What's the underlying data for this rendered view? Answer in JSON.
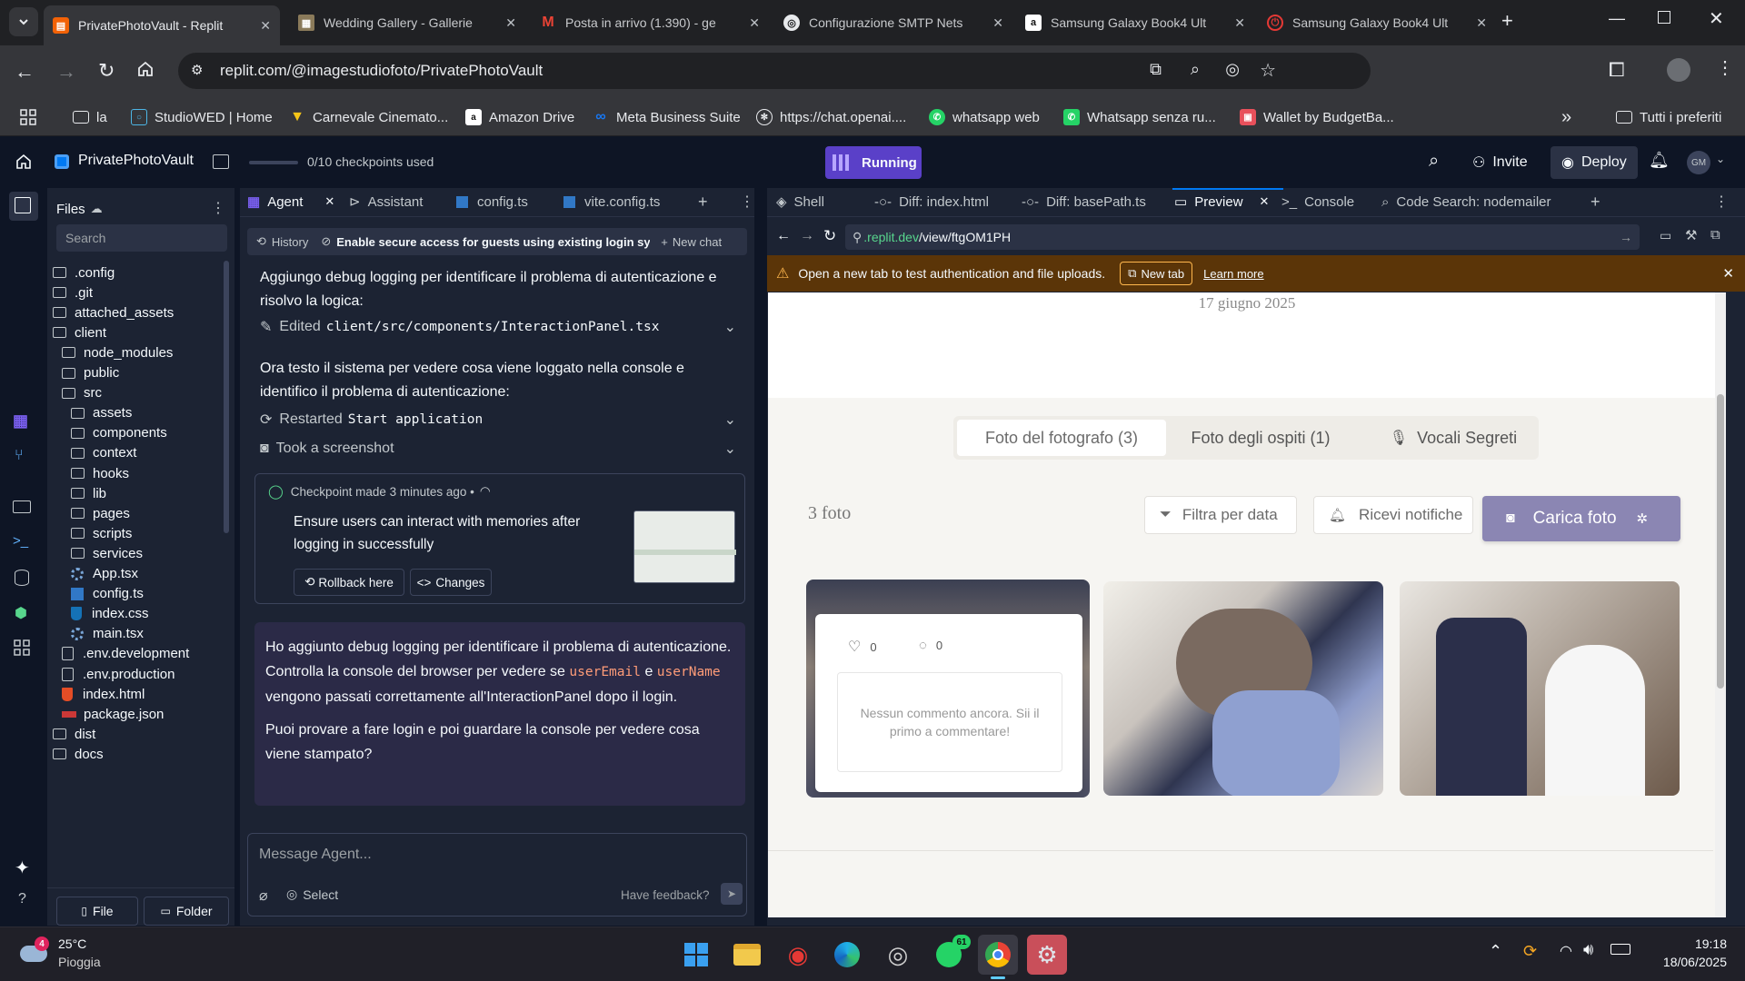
{
  "browser": {
    "tabs": [
      {
        "title": "PrivatePhotoVault - Replit",
        "active": true
      },
      {
        "title": "Wedding Gallery - Gallerie"
      },
      {
        "title": "Posta in arrivo (1.390) - ge"
      },
      {
        "title": "Configurazione SMTP Nets"
      },
      {
        "title": "Samsung Galaxy Book4 Ult"
      },
      {
        "title": "Samsung Galaxy Book4 Ult"
      }
    ],
    "url": "replit.com/@imagestudiofoto/PrivatePhotoVault",
    "bookmarks": [
      {
        "label": "la",
        "icon": "folder-icon"
      },
      {
        "label": "StudioWED | Home"
      },
      {
        "label": "Carnevale Cinemato..."
      },
      {
        "label": "Amazon Drive"
      },
      {
        "label": "Meta Business Suite"
      },
      {
        "label": "https://chat.openai...."
      },
      {
        "label": "whatsapp web"
      },
      {
        "label": "Whatsapp senza ru..."
      },
      {
        "label": "Wallet by BudgetBa..."
      }
    ],
    "bookmarks_all": "Tutti i preferiti"
  },
  "replit": {
    "project_name": "PrivatePhotoVault",
    "checkpoints": "0/10 checkpoints used",
    "run_label": "Running",
    "invite": "Invite",
    "deploy": "Deploy",
    "avatar": "GM",
    "files_title": "Files",
    "search_placeholder": "Search",
    "tree": [
      {
        "name": ".config",
        "type": "folder",
        "depth": 0
      },
      {
        "name": ".git",
        "type": "folder",
        "depth": 0
      },
      {
        "name": "attached_assets",
        "type": "folder",
        "depth": 0
      },
      {
        "name": "client",
        "type": "folder",
        "depth": 0
      },
      {
        "name": "node_modules",
        "type": "folder",
        "depth": 1
      },
      {
        "name": "public",
        "type": "folder",
        "depth": 1
      },
      {
        "name": "src",
        "type": "folder",
        "depth": 1
      },
      {
        "name": "assets",
        "type": "folder",
        "depth": 2
      },
      {
        "name": "components",
        "type": "folder",
        "depth": 2
      },
      {
        "name": "context",
        "type": "folder",
        "depth": 2
      },
      {
        "name": "hooks",
        "type": "folder",
        "depth": 2
      },
      {
        "name": "lib",
        "type": "folder",
        "depth": 2
      },
      {
        "name": "pages",
        "type": "folder",
        "depth": 2
      },
      {
        "name": "scripts",
        "type": "folder",
        "depth": 2
      },
      {
        "name": "services",
        "type": "folder",
        "depth": 2
      },
      {
        "name": "App.tsx",
        "type": "react",
        "depth": 2
      },
      {
        "name": "config.ts",
        "type": "ts",
        "depth": 2
      },
      {
        "name": "index.css",
        "type": "css",
        "depth": 2
      },
      {
        "name": "main.tsx",
        "type": "react",
        "depth": 2
      },
      {
        "name": ".env.development",
        "type": "file",
        "depth": 1
      },
      {
        "name": ".env.production",
        "type": "file",
        "depth": 1
      },
      {
        "name": "index.html",
        "type": "html",
        "depth": 1
      },
      {
        "name": "package.json",
        "type": "npm",
        "depth": 1
      },
      {
        "name": "dist",
        "type": "folder",
        "depth": 0
      },
      {
        "name": "docs",
        "type": "folder",
        "depth": 0
      }
    ],
    "new_file": "File",
    "new_folder": "Folder",
    "agent_tabs": [
      "Agent",
      "Assistant",
      "config.ts",
      "vite.config.ts"
    ],
    "history": "History",
    "chat_title": "Enable secure access for guests using existing login sy...",
    "new_chat": "New chat",
    "msg1": "Aggiungo debug logging per identificare il problema di autenticazione e risolvo la logica:",
    "edited_label": "Edited",
    "edited_file": "client/src/components/InteractionPanel.tsx",
    "msg2": "Ora testo il sistema per vedere cosa viene loggato nella console e identifico il problema di autenticazione:",
    "restarted_label": "Restarted",
    "restarted_value": "Start application",
    "screenshot_label": "Took a screenshot",
    "checkpoint_title": "Checkpoint made 3 minutes ago •",
    "checkpoint_desc": "Ensure users can interact with memories after logging in successfully",
    "rollback": "Rollback here",
    "changes": "Changes",
    "reply_p1_a": "Ho aggiunto debug logging per identificare il problema di autenticazione. Controlla la console del browser per vedere se",
    "reply_code1": "userEmail",
    "reply_p1_b": "e",
    "reply_code2": "userName",
    "reply_p1_c": "vengono passati correttamente all'InteractionPanel dopo il login.",
    "reply_p2": "Puoi provare a fare login e poi guardare la console per vedere cosa viene stampato?",
    "message_placeholder": "Message Agent...",
    "select": "Select",
    "feedback": "Have feedback?",
    "preview_tabs": [
      "Shell",
      "Diff: index.html",
      "Diff: basePath.ts",
      "Preview",
      "Console",
      "Code Search: nodemailer"
    ],
    "preview_url_domain": ".replit.dev",
    "preview_url_path": "/view/ftgOM1PH",
    "warning": "Open a new tab to test authentication and file uploads.",
    "new_tab": "New tab",
    "learn_more": "Learn more"
  },
  "app": {
    "date": "17 giugno 2025",
    "tabs": [
      "Foto del fotografo (3)",
      "Foto degli ospiti (1)",
      "Vocali Segreti"
    ],
    "photo_count": "3 foto",
    "filter": "Filtra per data",
    "notify": "Ricevi notifiche",
    "upload": "Carica foto",
    "likes": "0",
    "comments": "0",
    "no_comments": "Nessun commento ancora. Sii il primo a commentare!"
  },
  "taskbar": {
    "temp": "25°C",
    "weather": "Pioggia",
    "weather_badge": "4",
    "whatsapp_badge": "61",
    "time": "19:18",
    "date": "18/06/2025"
  },
  "colors": {
    "replit_bg": "#0e1525",
    "panel": "#1c2333",
    "accent": "#7a5ff0",
    "warning_bar": "#5b3508",
    "upload_btn": "#8b86b3",
    "reply_bubble": "#2b2a47"
  }
}
